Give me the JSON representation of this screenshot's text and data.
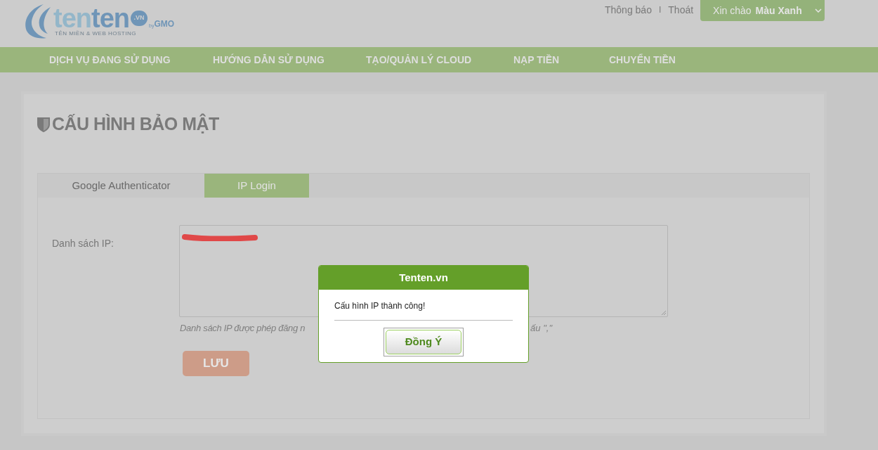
{
  "logo": {
    "wordmark_1": "ten",
    "wordmark_2": "ten",
    "badge": ".VN",
    "by": "by",
    "company": "GMO",
    "tagline": "TÊN MIỀN & WEB HOSTING"
  },
  "top_links": [
    "Thông báo",
    "Thoát"
  ],
  "top_separator": "I",
  "user_menu": {
    "greeting": "Xin chào",
    "name": "Màu Xanh"
  },
  "nav": [
    "DỊCH VỤ ĐANG SỬ DỤNG",
    "HƯỚNG DẪN SỬ DỤNG",
    "TẠO/QUẢN LÝ CLOUD",
    "NẠP TIỀN",
    "CHUYỂN TIỀN"
  ],
  "page_title": "CẤU HÌNH BẢO MẬT",
  "tabs": [
    {
      "label": "Google Authenticator",
      "selected": false
    },
    {
      "label": "IP Login",
      "selected": true
    }
  ],
  "form": {
    "label": "Danh sách IP:",
    "hint_visible_start": "Danh sách IP được phép đăng n",
    "hint_visible_end": "ấu \",\"",
    "save_button": "LƯU"
  },
  "dialog": {
    "title": "Tenten.vn",
    "message": "Cấu hình IP thành công!",
    "button": "Đồng Ý"
  }
}
